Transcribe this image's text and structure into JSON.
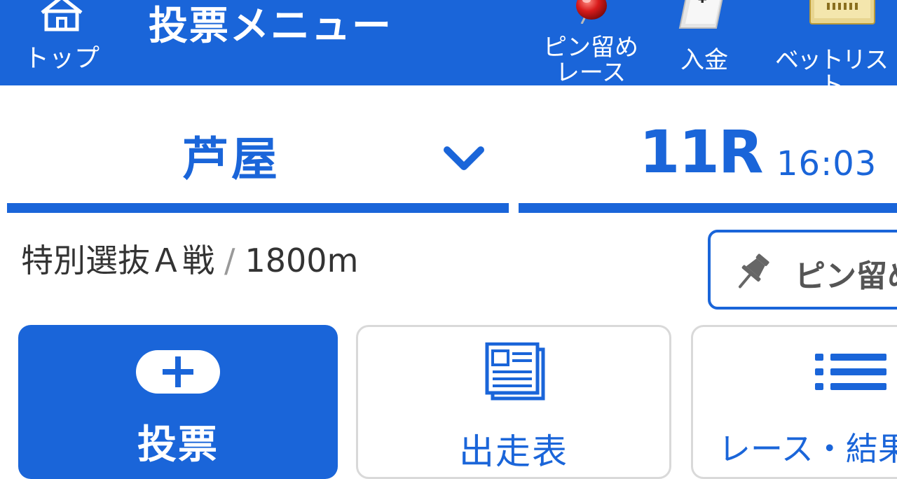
{
  "header": {
    "top_label": "トップ",
    "title": "投票メニュー",
    "pin_race_label": "ピン留め\nレース",
    "deposit_label": "入金",
    "betlist_label": "ベットリスト",
    "background_color": "#1a65d9"
  },
  "selector": {
    "venue": "芦屋",
    "race_number": "11R",
    "race_time": "16:03",
    "accent_color": "#1a65d9"
  },
  "race_info": {
    "race_name": "特別選抜Ａ戦",
    "separator": "/",
    "distance": "1800m"
  },
  "pin_button": {
    "label": "ピン留め"
  },
  "tiles": {
    "vote_label": "投票",
    "entry_label": "出走表",
    "results_label": "レース・結果"
  },
  "icons": {
    "top": "home-icon",
    "pin_race": "red-pin-icon",
    "deposit": "yen-card-icon",
    "betlist": "ticket-icon",
    "venue_dropdown": "chevron-down-icon",
    "pin_button": "pushpin-icon",
    "vote": "plus-icon",
    "entry": "newspaper-icon",
    "results": "list-icon"
  }
}
